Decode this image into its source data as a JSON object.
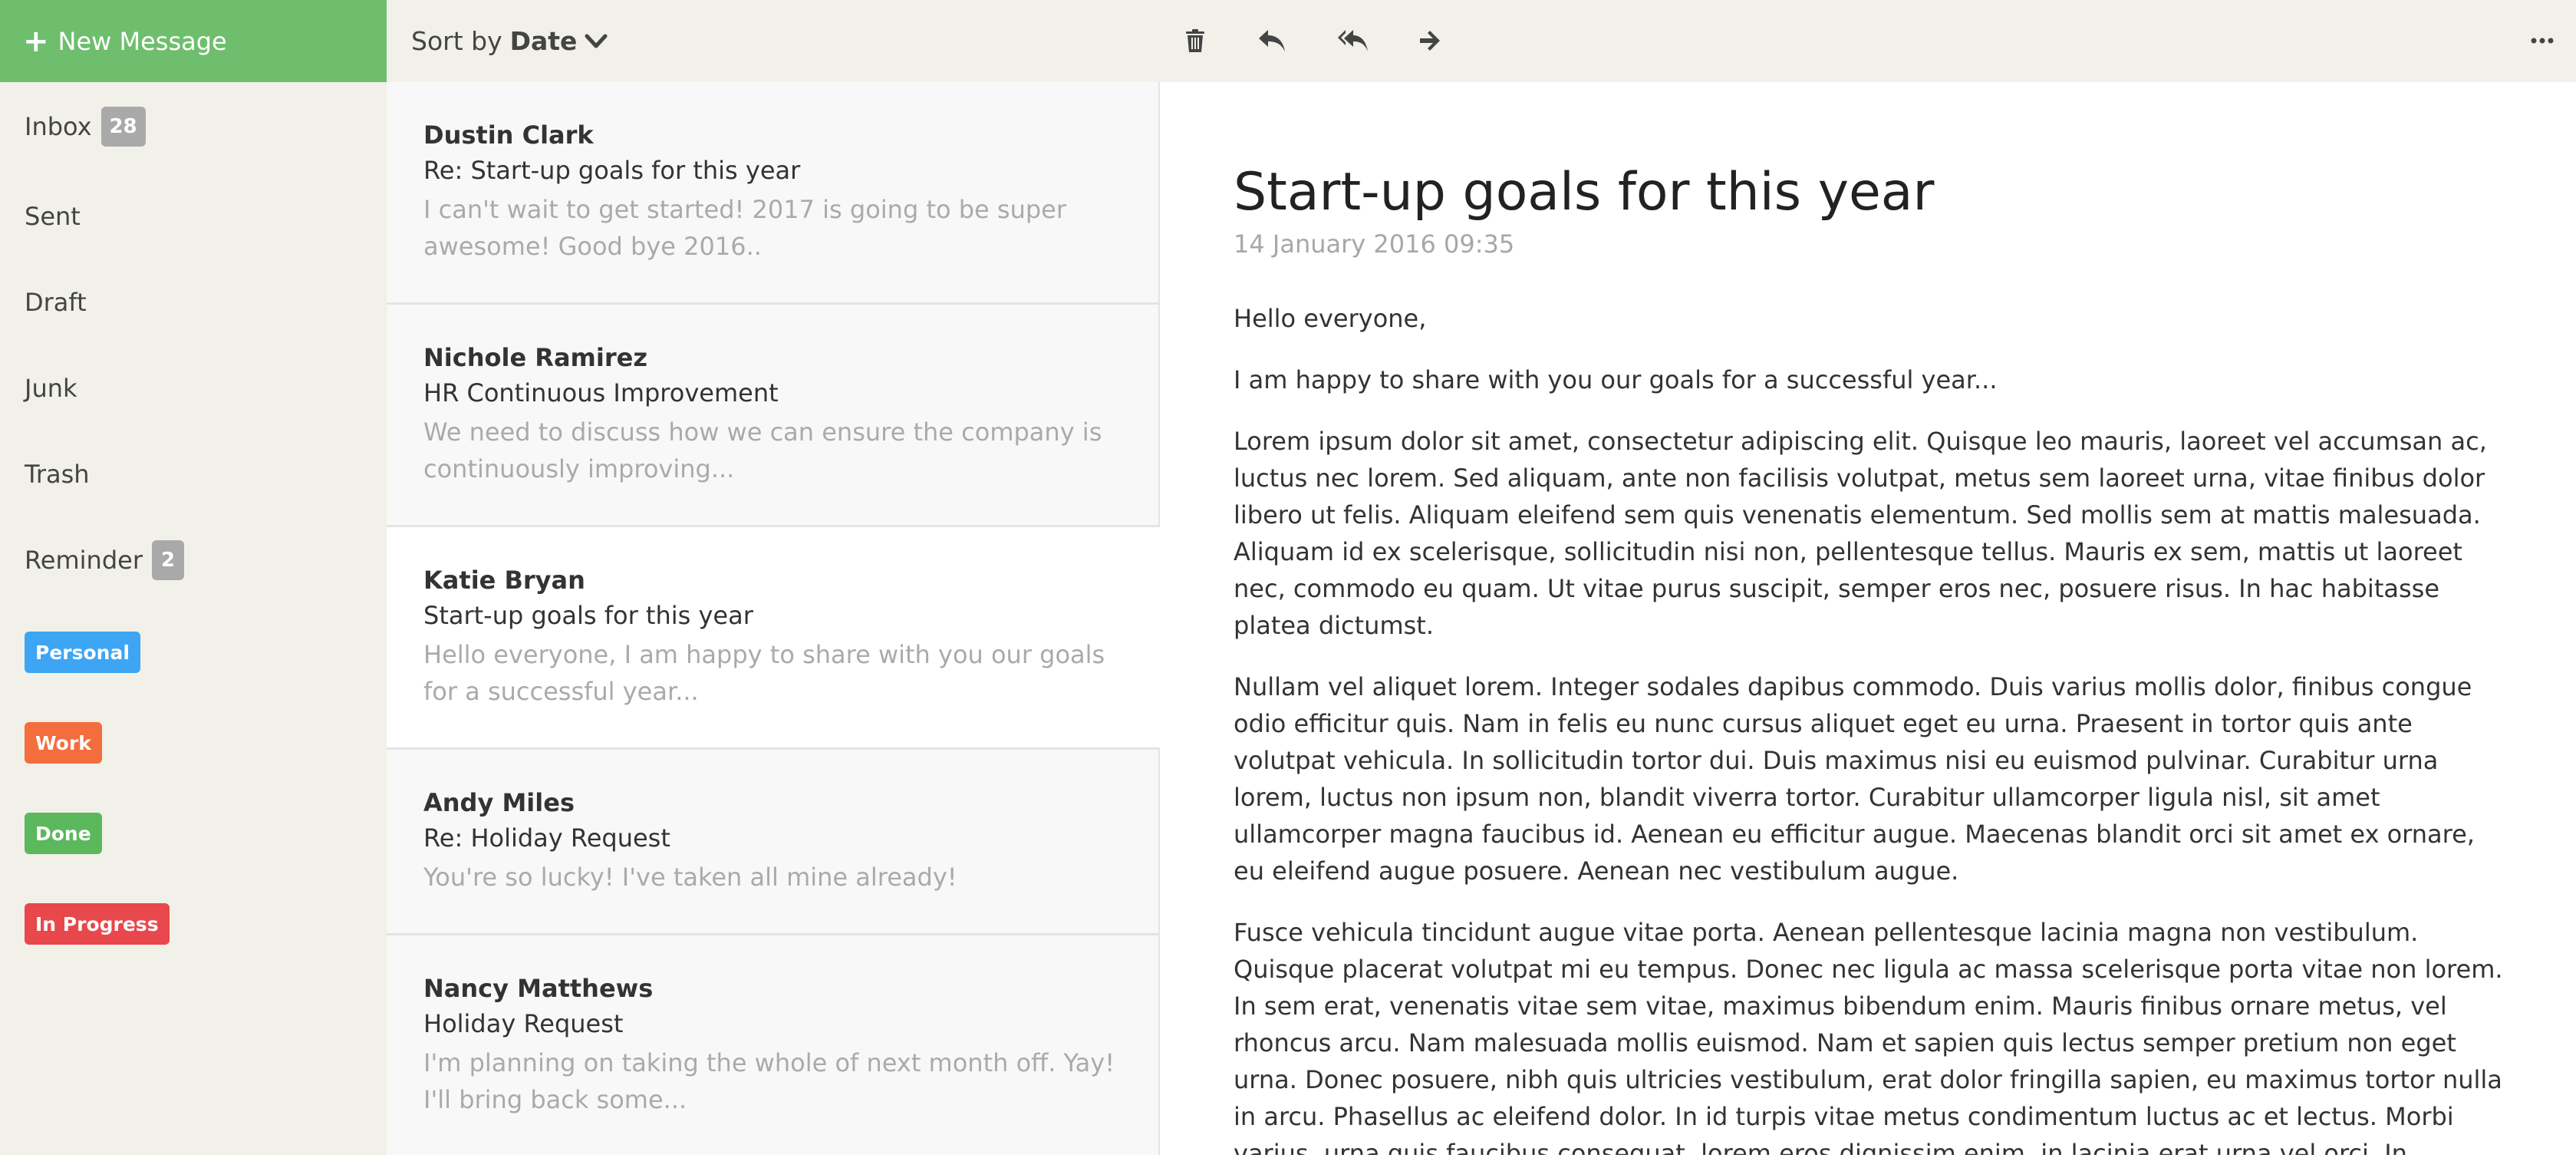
{
  "sidebar": {
    "new_message_label": "New Message",
    "folders": [
      {
        "label": "Inbox",
        "count": "28"
      },
      {
        "label": "Sent"
      },
      {
        "label": "Draft"
      },
      {
        "label": "Junk"
      },
      {
        "label": "Trash"
      },
      {
        "label": "Reminder",
        "count": "2"
      }
    ],
    "tags": [
      {
        "label": "Personal",
        "color": "#3da5f4"
      },
      {
        "label": "Work",
        "color": "#f46d3d"
      },
      {
        "label": "Done",
        "color": "#5cb85c"
      },
      {
        "label": "In Progress",
        "color": "#e8474c"
      }
    ],
    "accent_color": "#6ebe6e"
  },
  "toolbar": {
    "sort_prefix": "Sort by",
    "sort_value": "Date",
    "icons": [
      "trash-icon",
      "reply-icon",
      "reply-all-icon",
      "forward-icon",
      "more-icon"
    ]
  },
  "messages": [
    {
      "from": "Dustin Clark",
      "subject": "Re: Start-up goals for this year",
      "preview": "I can't wait to get started! 2017 is going to be super awesome! Good bye 2016.."
    },
    {
      "from": "Nichole Ramirez",
      "subject": "HR Continuous Improvement",
      "preview": "We need to discuss how we can ensure the company is continuously improving..."
    },
    {
      "from": "Katie Bryan",
      "subject": "Start-up goals for this year",
      "preview": "Hello everyone, I am happy to share with you our goals for a successful year..."
    },
    {
      "from": "Andy Miles",
      "subject": "Re: Holiday Request",
      "preview": "You're so lucky! I've taken all mine already!"
    },
    {
      "from": "Nancy Matthews",
      "subject": "Holiday Request",
      "preview": "I'm planning on taking the whole of next month off. Yay! I'll bring back some..."
    }
  ],
  "reader": {
    "title": "Start-up goals for this year",
    "date": "14 January 2016 09:35",
    "paragraphs": [
      "Hello everyone,",
      "I am happy to share with you our goals for a successful year...",
      "Lorem ipsum dolor sit amet, consectetur adipiscing elit. Quisque leo mauris, laoreet vel accumsan ac, luctus nec lorem. Sed aliquam, ante non facilisis volutpat, metus sem laoreet urna, vitae finibus dolor libero ut felis. Aliquam eleifend sem quis venenatis elementum. Sed mollis sem at mattis malesuada. Aliquam id ex scelerisque, sollicitudin nisi non, pellentesque tellus. Mauris ex sem, mattis ut laoreet nec, commodo eu quam. Ut vitae purus suscipit, semper eros nec, posuere risus. In hac habitasse platea dictumst.",
      "Nullam vel aliquet lorem. Integer sodales dapibus commodo. Duis varius mollis dolor, finibus congue odio efficitur quis. Nam in felis eu nunc cursus aliquet eget eu urna. Praesent in tortor quis ante volutpat vehicula. In sollicitudin tortor dui. Duis maximus nisi eu euismod pulvinar. Curabitur urna lorem, luctus non ipsum non, blandit viverra tortor. Curabitur ullamcorper ligula nisl, sit amet ullamcorper magna faucibus id. Aenean eu efficitur augue. Maecenas blandit orci sit amet ex ornare, eu eleifend augue posuere. Aenean nec vestibulum augue.",
      "Fusce vehicula tincidunt augue vitae porta. Aenean pellentesque lacinia magna non vestibulum. Quisque placerat volutpat mi eu tempus. Donec nec ligula ac massa scelerisque porta vitae non lorem. In sem erat, venenatis vitae sem vitae, maximus bibendum enim. Mauris finibus ornare metus, vel rhoncus arcu. Nam malesuada mollis euismod. Nam et sapien quis lectus semper pretium non eget urna. Donec posuere, nibh quis ultricies vestibulum, erat dolor fringilla sapien, eu maximus tortor nulla in arcu. Phasellus ac eleifend dolor. In id turpis vitae metus condimentum luctus ac et lectus. Morbi varius, urna quis faucibus consequat, lorem eros dignissim enim, in lacinia erat urna vel orci. In congue, nibh nec consectetur commodo, sem felis"
    ]
  }
}
